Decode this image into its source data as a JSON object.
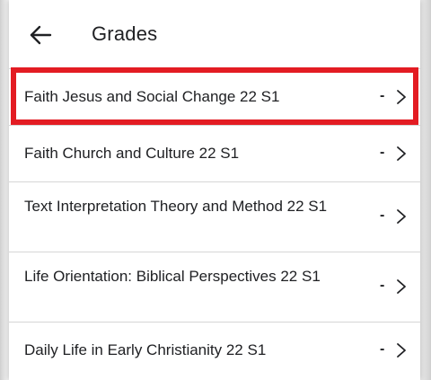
{
  "header": {
    "title": "Grades",
    "back_icon": "arrow-left-icon"
  },
  "courses": [
    {
      "name": "Faith Jesus and Social Change 22 S1",
      "grade": "-",
      "highlighted": true
    },
    {
      "name": "Faith Church and Culture 22 S1",
      "grade": "-"
    },
    {
      "name": "Text Interpretation Theory and Method 22 S1",
      "grade": "-"
    },
    {
      "name": "Life Orientation: Biblical Perspectives 22 S1",
      "grade": "-"
    },
    {
      "name": "Daily Life in Early Christianity 22 S1",
      "grade": "-"
    }
  ],
  "colors": {
    "highlight": "#e31c23",
    "text": "#202124",
    "divider": "#d6d6d6"
  },
  "icons": {
    "row_chevron": "chevron-right-icon"
  }
}
